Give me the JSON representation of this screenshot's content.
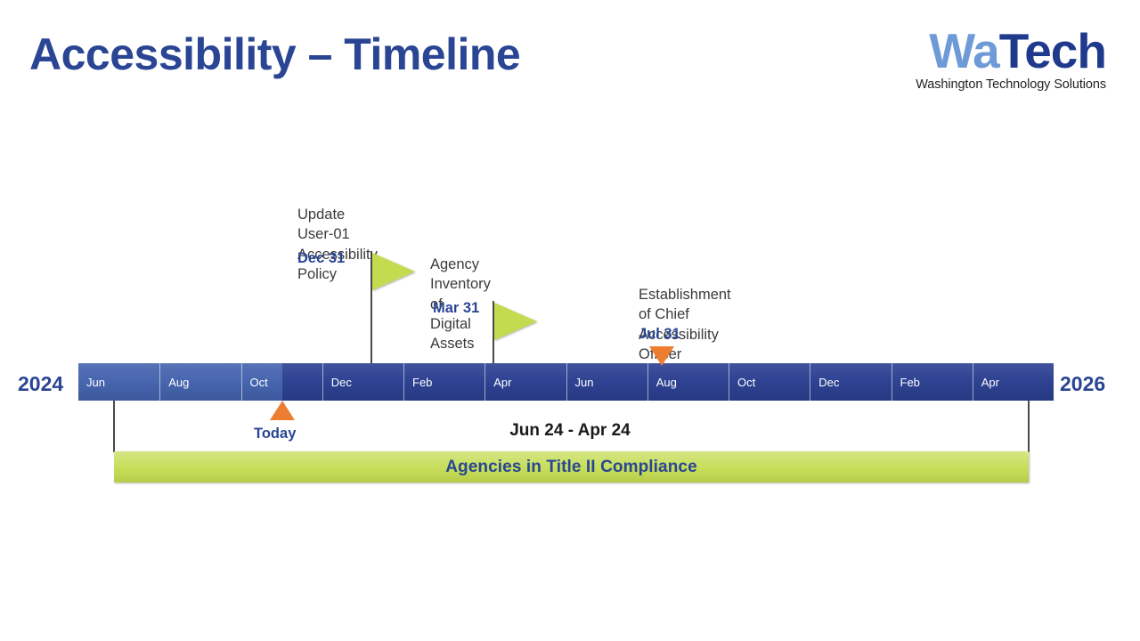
{
  "slide": {
    "title": "Accessibility – Timeline"
  },
  "logo": {
    "word_light": "Wa",
    "word_dark": "Tech",
    "tagline": "Washington Technology Solutions"
  },
  "timeline": {
    "start_year": "2024",
    "end_year": "2026",
    "months": [
      "Jun",
      "Aug",
      "Oct",
      "Dec",
      "Feb",
      "Apr",
      "Jun",
      "Aug",
      "Oct",
      "Dec",
      "Feb",
      "Apr"
    ],
    "today_label": "Today",
    "colors": {
      "past_segment": "#4463AE",
      "future_segment": "#2B3F91",
      "accent_blue": "#2A4593",
      "marker_orange": "#ED7D31",
      "phase_green": "#C3DC4F"
    }
  },
  "milestones": [
    {
      "title": "Update User-01\nAccessibility Policy",
      "date": "Dec 31",
      "marker": "flag-icon"
    },
    {
      "title": "Agency Inventory of\nDigital Assets",
      "date": "Mar 31",
      "marker": "flag-icon"
    },
    {
      "title": "Establishment of Chief\nAccessibility Officer",
      "date": "Jul 31",
      "marker": "triangle-down-icon"
    }
  ],
  "phase": {
    "range_label": "Jun 24 - Apr 24",
    "bar_label": "Agencies in Title II Compliance"
  }
}
